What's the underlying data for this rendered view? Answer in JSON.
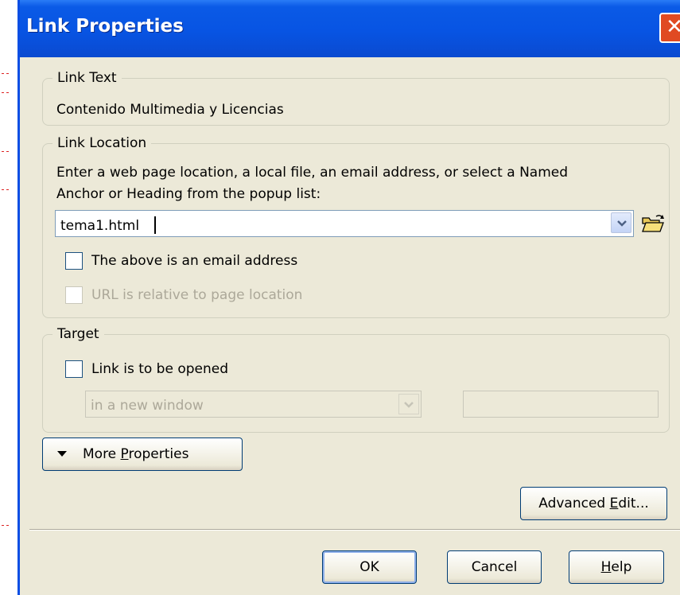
{
  "window": {
    "title": "Link Properties",
    "close_glyph": "✕"
  },
  "link_text": {
    "legend": "Link Text",
    "value": "Contenido Multimedia y Licencias"
  },
  "link_location": {
    "legend": "Link Location",
    "instructions_line1": "Enter a web page location, a local file, an email address, or select a Named",
    "instructions_line2": "Anchor or Heading from the popup list:",
    "url_value": "tema1.html",
    "dropdown_icon": "chevron-down-icon",
    "browse_icon": "open-folder-icon",
    "email_checkbox_label": "The above is an email address",
    "email_checked": false,
    "relative_checkbox_label": "URL is relative to page location",
    "relative_checked": false,
    "relative_enabled": false
  },
  "target": {
    "legend": "Target",
    "open_checkbox_label": "Link is to be opened",
    "open_checked": false,
    "window_select_value": "in a new window",
    "frame_name_value": ""
  },
  "buttons": {
    "more_properties": {
      "prefix": "More ",
      "mnemonic": "P",
      "suffix": "roperties"
    },
    "advanced_edit": {
      "prefix": "Advanced ",
      "mnemonic": "E",
      "suffix": "dit..."
    },
    "ok": "OK",
    "cancel": "Cancel",
    "help": {
      "mnemonic": "H",
      "suffix": "elp"
    }
  },
  "colors": {
    "titlebar": "#0854e3",
    "dialog_bg": "#ece9d8",
    "close_button": "#e04a22",
    "border_blue": "#7f9db9"
  }
}
